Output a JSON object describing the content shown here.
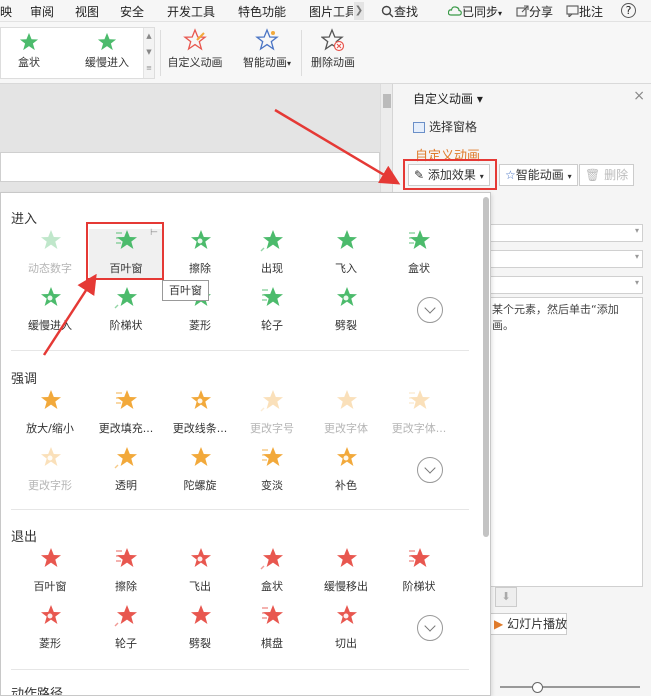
{
  "menu": [
    "映",
    "审阅",
    "视图",
    "安全",
    "开发工具",
    "特色功能",
    "图片工具"
  ],
  "menu_right": {
    "search": "查找",
    "sync": "已同步",
    "share": "分享",
    "comment": "批注",
    "help": "?"
  },
  "ribbon": {
    "gallery_items": [
      "盒状",
      "缓慢进入"
    ],
    "custom_anim": "自定义动画",
    "smart_anim": "智能动画",
    "smart_anim_caret": "▾",
    "delete_anim": "删除动画"
  },
  "pane": {
    "title": "自定义动画 ▾",
    "select_pane": "选择窗格",
    "subtitle": "自定义动画",
    "add_effect": "添加效果",
    "smart_anim": "智能动画",
    "delete": "删除",
    "hint": "某个元素，然后单击“添加画。",
    "play": "幻灯片播放",
    "close": "×"
  },
  "dropdown": {
    "sections": {
      "enter": "进入",
      "emphasis": "强调",
      "exit": "退出",
      "path": "动作路径"
    },
    "tooltip": "百叶窗",
    "enter": [
      {
        "label": "动态数字",
        "disabled": true
      },
      {
        "label": "百叶窗",
        "selected": true
      },
      {
        "label": "擦除"
      },
      {
        "label": "出现"
      },
      {
        "label": "飞入"
      },
      {
        "label": "盒状"
      },
      {
        "label": "缓慢进入"
      },
      {
        "label": "阶梯状"
      },
      {
        "label": "菱形"
      },
      {
        "label": "轮子"
      },
      {
        "label": "劈裂"
      }
    ],
    "emphasis": [
      {
        "label": "放大/缩小"
      },
      {
        "label": "更改填充..."
      },
      {
        "label": "更改线条..."
      },
      {
        "label": "更改字号",
        "disabled": true
      },
      {
        "label": "更改字体",
        "disabled": true
      },
      {
        "label": "更改字体...",
        "disabled": true
      },
      {
        "label": "更改字形",
        "disabled": true
      },
      {
        "label": "透明"
      },
      {
        "label": "陀螺旋"
      },
      {
        "label": "变淡"
      },
      {
        "label": "补色"
      }
    ],
    "exit": [
      {
        "label": "百叶窗"
      },
      {
        "label": "擦除"
      },
      {
        "label": "飞出"
      },
      {
        "label": "盒状"
      },
      {
        "label": "缓慢移出"
      },
      {
        "label": "阶梯状"
      },
      {
        "label": "菱形"
      },
      {
        "label": "轮子"
      },
      {
        "label": "劈裂"
      },
      {
        "label": "棋盘"
      },
      {
        "label": "切出"
      }
    ]
  },
  "colors": {
    "enter_star": "#4cbb6c",
    "emphasis_star": "#f2a93b",
    "exit_star": "#e8574f",
    "highlight": "#e53935",
    "accent": "#e07b2b"
  }
}
